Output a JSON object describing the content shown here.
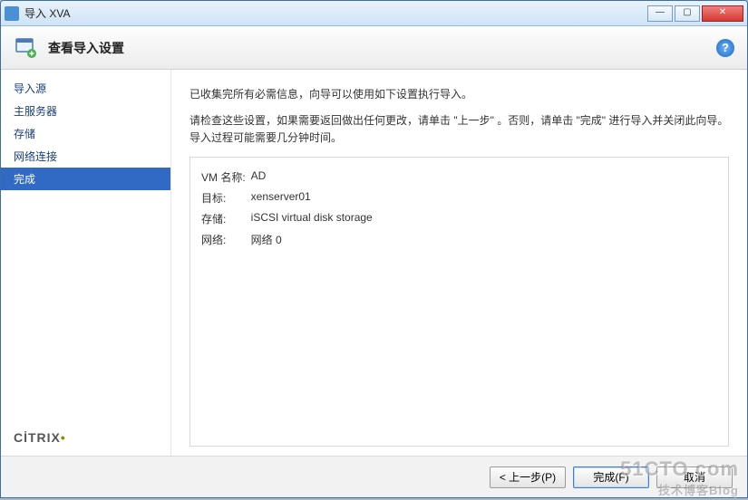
{
  "window": {
    "title": "导入 XVA"
  },
  "header": {
    "heading": "查看导入设置"
  },
  "sidebar": {
    "items": [
      {
        "label": "导入源"
      },
      {
        "label": "主服务器"
      },
      {
        "label": "存储"
      },
      {
        "label": "网络连接"
      },
      {
        "label": "完成"
      }
    ],
    "active_index": 4,
    "brand": "CİTRIX"
  },
  "content": {
    "intro": "已收集完所有必需信息，向导可以使用如下设置执行导入。",
    "instructions": "请检查这些设置，如果需要返回做出任何更改，请单击 \"上一步\" 。否则，请单击 \"完成\" 进行导入并关闭此向导。导入过程可能需要几分钟时间。",
    "summary": [
      {
        "label": "VM 名称:",
        "value": "AD"
      },
      {
        "label": "目标:",
        "value": "xenserver01"
      },
      {
        "label": "存储:",
        "value": "iSCSI virtual disk storage"
      },
      {
        "label": "网络:",
        "value": "网络 0"
      }
    ]
  },
  "footer": {
    "prev": "< 上一步(P)",
    "finish": "完成(F)",
    "cancel": "取消"
  },
  "watermark": {
    "main": "51CTO.com",
    "sub": "技术博客Blog"
  }
}
